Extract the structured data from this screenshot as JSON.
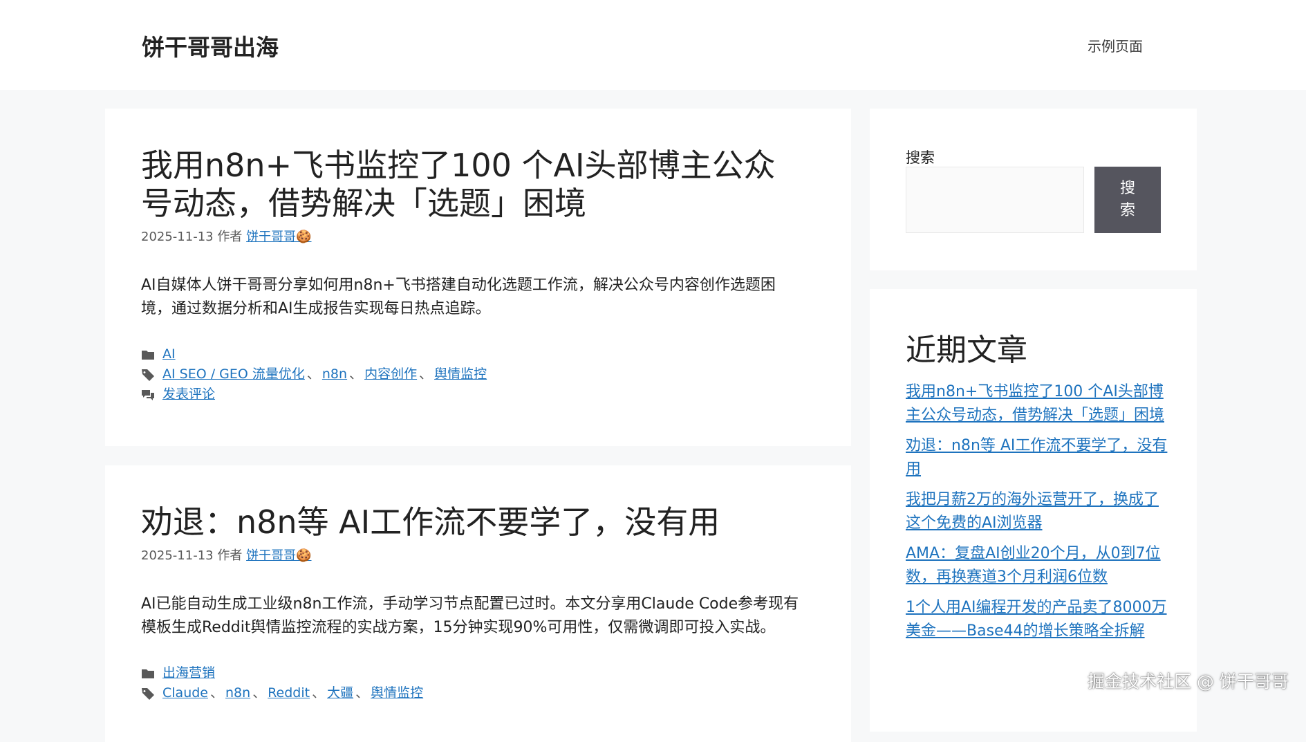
{
  "header": {
    "site_title": "饼干哥哥出海",
    "nav_item": "示例页面"
  },
  "posts": [
    {
      "title": "我用n8n+飞书监控了100 个AI头部博主公众号动态，借势解决「选题」困境",
      "date": "2025-11-13",
      "author_prefix": "作者",
      "author": "饼干哥哥🍪",
      "excerpt": "AI自媒体人饼干哥哥分享如何用n8n+飞书搭建自动化选题工作流，解决公众号内容创作选题困境，通过数据分析和AI生成报告实现每日热点追踪。",
      "category": "AI",
      "tags": [
        "AI SEO / GEO 流量优化",
        "n8n",
        "内容创作",
        "舆情监控"
      ],
      "comment_link": "发表评论"
    },
    {
      "title": "劝退：n8n等 AI工作流不要学了，没有用",
      "date": "2025-11-13",
      "author_prefix": "作者",
      "author": "饼干哥哥🍪",
      "excerpt": "AI已能自动生成工业级n8n工作流，手动学习节点配置已过时。本文分享用Claude Code参考现有模板生成Reddit舆情监控流程的实战方案，15分钟实现90%可用性，仅需微调即可投入实战。",
      "category": "出海营销",
      "tags": [
        "Claude",
        "n8n",
        "Reddit",
        "大疆",
        "舆情监控"
      ]
    }
  ],
  "sidebar": {
    "search_label": "搜索",
    "search_value": "",
    "search_button": "搜索",
    "recent_title": "近期文章",
    "recent_posts": [
      "我用n8n+飞书监控了100 个AI头部博主公众号动态，借势解决「选题」困境",
      "劝退：n8n等 AI工作流不要学了，没有用",
      "我把月薪2万的海外运营开了，换成了这个免费的AI浏览器",
      "AMA：复盘AI创业20个月，从0到7位数，再换赛道3个月利润6位数",
      "1个人用AI编程开发的产品卖了8000万美金——Base44的增长策略全拆解"
    ]
  },
  "watermark": "掘金技术社区 @ 饼干哥哥"
}
